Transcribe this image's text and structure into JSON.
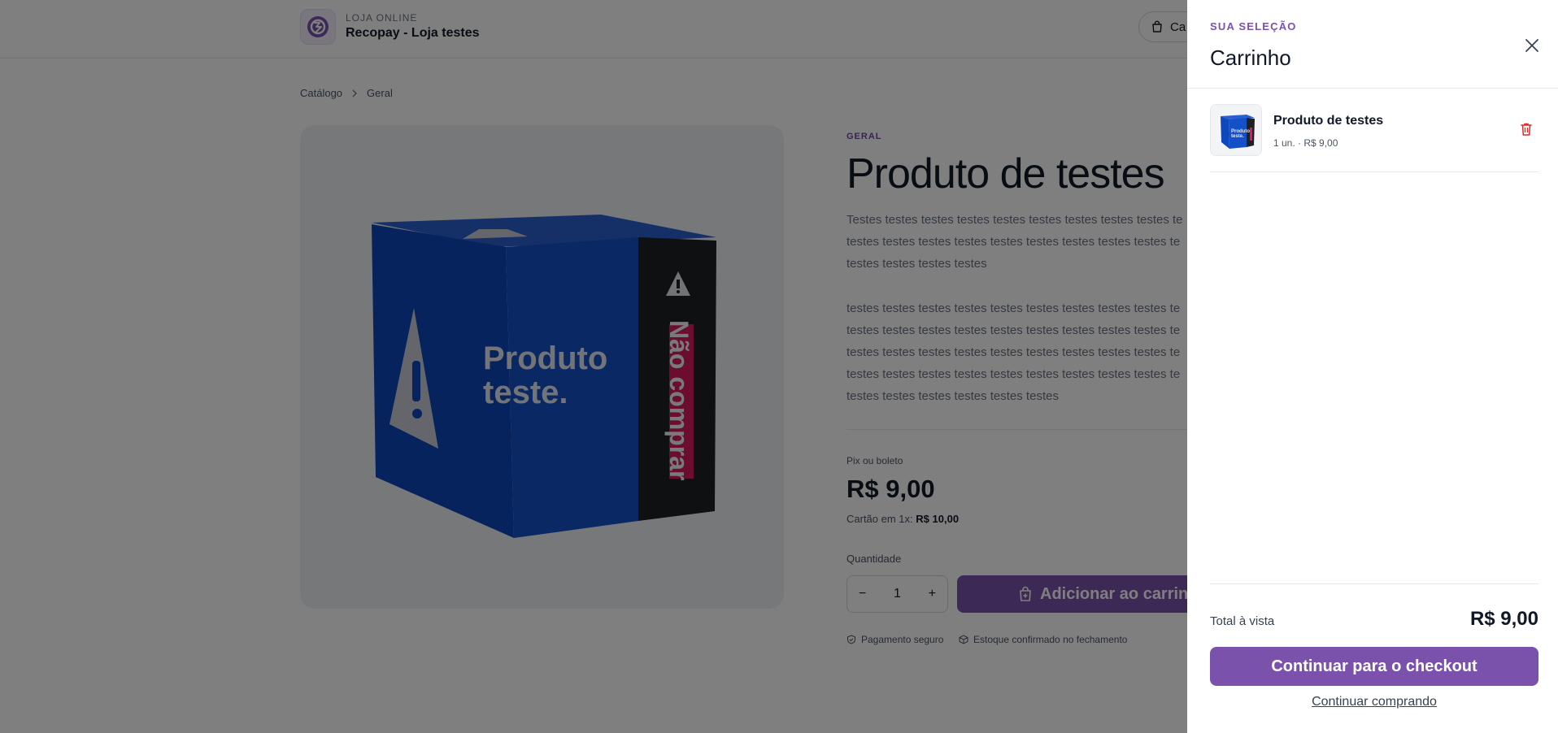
{
  "header": {
    "kicker": "LOJA ONLINE",
    "store_name": "Recopay - Loja testes",
    "cart_button_label": "Ca"
  },
  "breadcrumb": {
    "items": [
      "Catálogo",
      "Geral"
    ]
  },
  "product": {
    "image_text_front": "Produto teste.",
    "image_text_side": "Não comprar",
    "category": "GERAL",
    "title": "Produto de testes",
    "description_1": [
      "Testes testes testes testes testes testes testes testes testes te",
      "testes testes testes testes testes testes testes testes testes te",
      "testes testes testes testes"
    ],
    "description_2": [
      "testes testes testes testes testes testes testes testes testes te",
      "testes testes testes testes testes testes testes testes testes te",
      "testes testes testes testes testes testes testes testes testes te",
      "testes testes testes testes testes testes testes testes testes te",
      "testes testes testes testes testes testes"
    ],
    "payment_label": "Pix ou boleto",
    "price": "R$ 9,00",
    "card_label": "Cartão em 1x:",
    "card_price": "R$ 10,00",
    "quantity_label": "Quantidade",
    "quantity_value": "1",
    "decrement": "−",
    "increment": "+",
    "add_to_cart_label": "Adicionar ao carrinh",
    "trust_secure": "Pagamento seguro",
    "trust_stock": "Estoque confirmado no fechamento"
  },
  "drawer": {
    "kicker": "SUA SELEÇÃO",
    "title": "Carrinho",
    "items": [
      {
        "name": "Produto de testes",
        "meta": "1 un. · R$ 9,00"
      }
    ],
    "total_label": "Total à vista",
    "total_value": "R$ 9,00",
    "checkout_label": "Continuar para o checkout",
    "continue_label": "Continuar comprando"
  },
  "colors": {
    "accent": "#7b52ab",
    "danger": "#dc2626",
    "box_blue": "#1451c8",
    "box_dark": "#1f2023",
    "box_pink": "#d81b60"
  }
}
